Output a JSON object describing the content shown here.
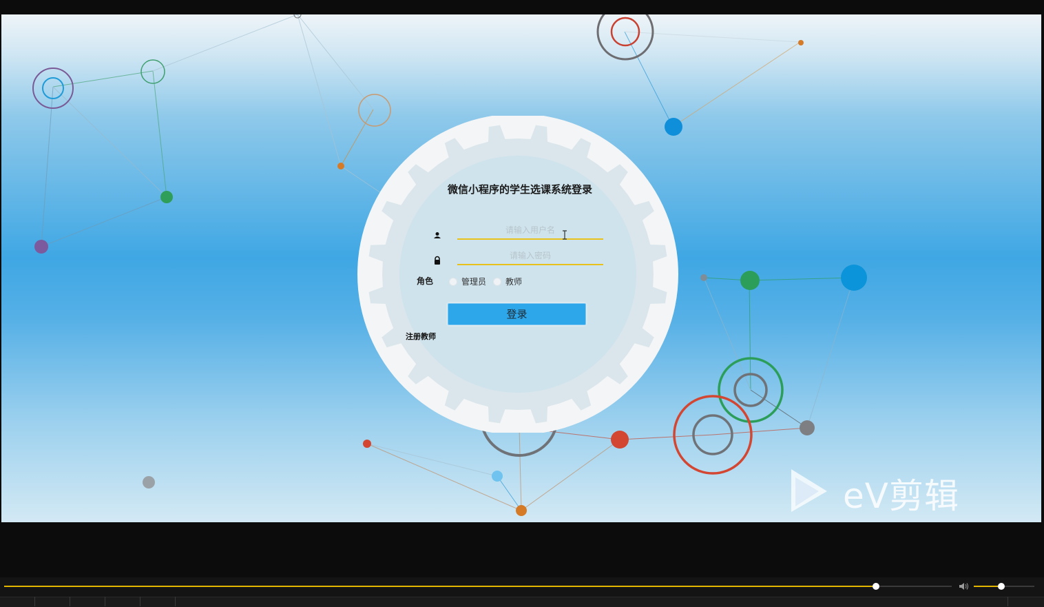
{
  "login": {
    "title": "微信小程序的学生选课系统登录",
    "username_placeholder": "请输入用户名",
    "password_placeholder": "请输入密码",
    "role_label": "角色",
    "role_options": [
      "管理员",
      "教师"
    ],
    "login_button": "登录",
    "register_link": "注册教师"
  },
  "watermark": {
    "text": "eV剪辑"
  },
  "player": {
    "progress": 0.92,
    "volume": 0.45
  },
  "colors": {
    "accent_yellow": "#e8c21a",
    "button_blue": "#2ea6ea",
    "seek_fill": "#e3b600"
  }
}
